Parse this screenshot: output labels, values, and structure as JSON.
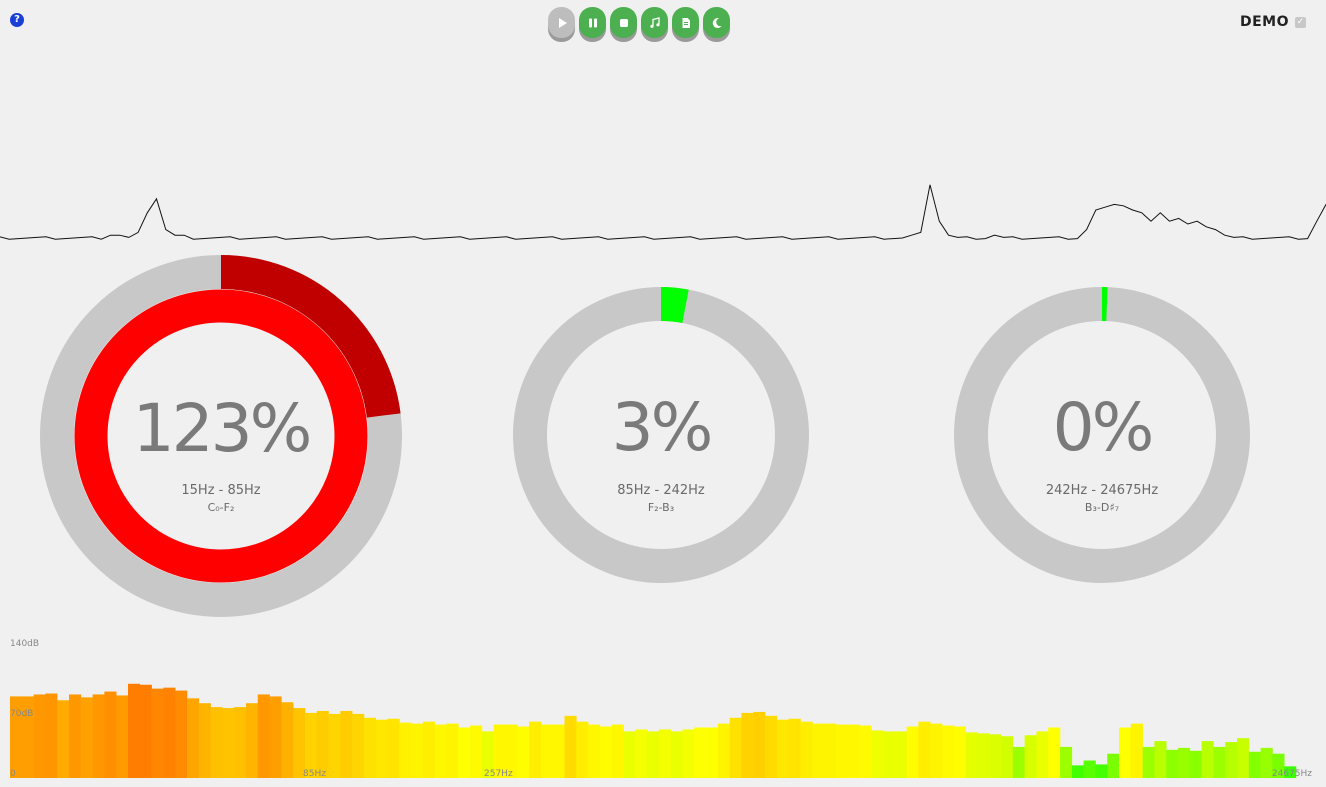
{
  "header": {
    "help_icon": "question-circle-icon",
    "help_glyph": "?",
    "toolbar": [
      {
        "name": "play",
        "icon": "play-icon",
        "enabled": false
      },
      {
        "name": "pause",
        "icon": "pause-icon",
        "enabled": true
      },
      {
        "name": "stop",
        "icon": "stop-icon",
        "enabled": true
      },
      {
        "name": "music",
        "icon": "music-note-icon",
        "enabled": true
      },
      {
        "name": "file",
        "icon": "file-icon",
        "enabled": true
      },
      {
        "name": "night",
        "icon": "moon-icon",
        "enabled": true
      }
    ],
    "demo_label": "DEMO",
    "demo_checked": true
  },
  "colors": {
    "background": "#f0f0f0",
    "track": "#c8c8c8",
    "over_red": "#ff0000",
    "over_dark_red": "#c00000",
    "green": "#00ff00",
    "button_green": "#4caf50",
    "text_grey": "#7a7a7a"
  },
  "gauges": [
    {
      "percent_label": "123%",
      "percent": 123,
      "range": "15Hz - 85Hz",
      "notes": "C₀-F₂"
    },
    {
      "percent_label": "3%",
      "percent": 3,
      "range": "85Hz - 242Hz",
      "notes": "F₂-B₃"
    },
    {
      "percent_label": "0%",
      "percent": 0.6,
      "range": "242Hz - 24675Hz",
      "notes": "B₃-D♯₇"
    }
  ],
  "spectrum": {
    "y_labels": {
      "top": "140dB",
      "mid": "70dB"
    },
    "x_labels": {
      "start": "0",
      "f1": "85Hz",
      "f2": "257Hz",
      "end": "24675Hz"
    },
    "db_max": 140,
    "levels_db": [
      84,
      84,
      86,
      87,
      80,
      86,
      83,
      86,
      89,
      85,
      97,
      96,
      92,
      93,
      90,
      82,
      77,
      73,
      72,
      73,
      77,
      86,
      84,
      78,
      72,
      67,
      69,
      66,
      69,
      66,
      62,
      60,
      61,
      57,
      56,
      58,
      55,
      56,
      52,
      54,
      48,
      55,
      55,
      53,
      58,
      55,
      55,
      64,
      58,
      55,
      53,
      55,
      48,
      50,
      48,
      50,
      48,
      50,
      52,
      52,
      56,
      62,
      67,
      68,
      64,
      60,
      61,
      58,
      56,
      56,
      55,
      55,
      54,
      49,
      48,
      48,
      53,
      58,
      56,
      54,
      53,
      47,
      46,
      45,
      43,
      32,
      44,
      48,
      52,
      32,
      13,
      18,
      14,
      25,
      52,
      56,
      32,
      38,
      29,
      31,
      28,
      38,
      32,
      37,
      41,
      27,
      31,
      25,
      12
    ]
  },
  "waveform": {
    "samples": [
      0,
      0,
      0,
      0,
      0,
      0,
      0,
      0,
      0,
      0,
      0,
      0,
      0.1,
      0.1,
      0,
      0.2,
      0.9,
      1.4,
      0.3,
      0.1,
      0.1,
      0,
      0,
      0,
      0,
      0,
      0,
      0,
      0,
      0,
      0,
      0,
      0,
      0,
      0,
      0,
      0,
      0,
      0,
      0,
      0,
      0,
      0,
      0,
      0,
      0,
      0,
      0,
      0,
      0,
      0,
      0,
      0,
      0,
      0,
      0,
      0,
      0,
      0,
      0,
      0,
      0,
      0,
      0,
      0,
      0,
      0,
      0,
      0,
      0,
      0,
      0,
      0,
      0,
      0,
      0,
      0,
      0,
      0,
      0,
      0,
      0,
      0,
      0,
      0,
      0,
      0,
      0,
      0,
      0,
      0,
      0,
      0,
      0,
      0,
      0,
      0,
      0,
      0,
      0.1,
      0.2,
      1.9,
      0.6,
      0.1,
      0,
      0,
      0,
      0,
      0.1,
      0,
      0,
      0,
      0,
      0,
      0,
      0,
      0,
      0,
      0.3,
      1.0,
      1.1,
      1.2,
      1.15,
      1.0,
      0.9,
      0.6,
      0.9,
      0.6,
      0.7,
      0.5,
      0.6,
      0.4,
      0.3,
      0.1,
      0,
      0,
      0,
      0,
      0,
      0,
      0,
      0,
      0,
      0.6,
      1.2
    ]
  }
}
